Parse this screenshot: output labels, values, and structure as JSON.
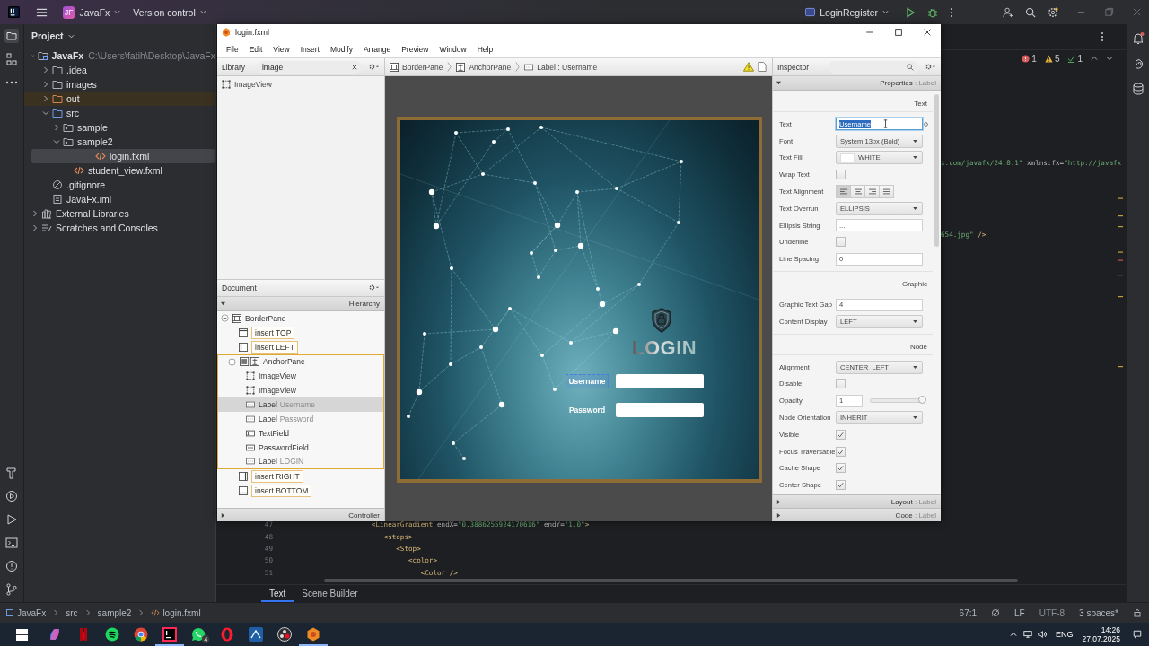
{
  "topbar": {
    "badge": "JF",
    "project": "JavaFx",
    "vcs": "Version control",
    "run_config": "LoginRegister"
  },
  "project": {
    "title": "Project",
    "tree": [
      {
        "label": "JavaFx",
        "detail": "C:\\Users\\fatih\\Desktop\\JavaFx",
        "kind": "module",
        "expanded": true,
        "selected": false,
        "children": [
          {
            "label": ".idea",
            "kind": "folder",
            "expanded": false,
            "selected": false
          },
          {
            "label": "images",
            "kind": "folder",
            "expanded": false,
            "selected": false
          },
          {
            "label": "out",
            "kind": "excluded",
            "expanded": false,
            "selected": false
          },
          {
            "label": "src",
            "kind": "source",
            "expanded": true,
            "selected": false,
            "children": [
              {
                "label": "sample",
                "kind": "package",
                "expanded": false,
                "selected": false
              },
              {
                "label": "sample2",
                "kind": "package",
                "expanded": true,
                "selected": false,
                "children": [
                  {
                    "label": "login.fxml",
                    "kind": "fxml",
                    "selected": true
                  },
                  {
                    "label": "student_view.fxml",
                    "kind": "fxml",
                    "selected": false
                  }
                ]
              }
            ]
          },
          {
            "label": ".gitignore",
            "kind": "ignore",
            "selected": false
          },
          {
            "label": "JavaFx.iml",
            "kind": "iml",
            "selected": false
          }
        ]
      },
      {
        "label": "External Libraries",
        "kind": "libraries",
        "expanded": false,
        "selected": false
      },
      {
        "label": "Scratches and Consoles",
        "kind": "scratches",
        "expanded": false,
        "selected": false
      }
    ]
  },
  "editor": {
    "inspections": {
      "errors": "1",
      "warnings": "5",
      "ok": "1"
    },
    "fragments": [
      [
        {
          "text": "x.com/javafx/24.0.1\"",
          "kind": "value"
        },
        {
          "text": " xmlns:fx",
          "kind": "attr"
        },
        {
          "text": "=",
          "kind": "plain"
        },
        {
          "text": "\"http://javafx",
          "kind": "value"
        }
      ],
      [
        {
          "text": "654.jpg\"",
          "kind": "value"
        },
        {
          "text": " />",
          "kind": "tag"
        }
      ]
    ],
    "lines": [
      {
        "number": "47",
        "tokens": [
          {
            "text": "            <LinearGradient",
            "kind": "tag"
          },
          {
            "text": " endX",
            "kind": "attr"
          },
          {
            "text": "=",
            "kind": "plain"
          },
          {
            "text": "\"0.3886255924170616\"",
            "kind": "value"
          },
          {
            "text": " endY",
            "kind": "attr"
          },
          {
            "text": "=",
            "kind": "plain"
          },
          {
            "text": "\"1.0\"",
            "kind": "value"
          },
          {
            "text": ">",
            "kind": "tag"
          }
        ]
      },
      {
        "number": "48",
        "tokens": [
          {
            "text": "               <stops>",
            "kind": "tag"
          }
        ]
      },
      {
        "number": "49",
        "tokens": [
          {
            "text": "                  <Stop>",
            "kind": "tag"
          }
        ]
      },
      {
        "number": "50",
        "tokens": [
          {
            "text": "                     <color>",
            "kind": "tag"
          }
        ]
      },
      {
        "number": "51",
        "tokens": [
          {
            "text": "                        <Color />",
            "kind": "tag"
          }
        ]
      }
    ],
    "tabs": [
      {
        "label": "Text",
        "selected": true
      },
      {
        "label": "Scene Builder",
        "selected": false
      }
    ]
  },
  "scene_builder": {
    "title": "login.fxml",
    "menu": [
      "File",
      "Edit",
      "View",
      "Insert",
      "Modify",
      "Arrange",
      "Preview",
      "Window",
      "Help"
    ],
    "library": {
      "title": "Library",
      "search": "image",
      "results": [
        "ImageView"
      ]
    },
    "document": {
      "title": "Document",
      "section": "Hierarchy",
      "footer": "Controller",
      "tree": [
        {
          "label": "BorderPane",
          "kind": "borderpane",
          "expanded": true,
          "selected": false,
          "children": [
            {
              "label": "insert TOP",
              "kind": "slot-top",
              "selected": false
            },
            {
              "label": "insert LEFT",
              "kind": "slot-left",
              "selected": false
            },
            {
              "label": "AnchorPane",
              "kind": "anchorpane",
              "expanded": true,
              "selected": false,
              "children": [
                {
                  "label": "ImageView",
                  "kind": "imageview",
                  "selected": false
                },
                {
                  "label": "ImageView",
                  "kind": "imageview",
                  "selected": false
                },
                {
                  "label": "Label",
                  "detail": "Username",
                  "kind": "label",
                  "selected": true
                },
                {
                  "label": "Label",
                  "detail": "Password",
                  "kind": "label",
                  "selected": false
                },
                {
                  "label": "TextField",
                  "kind": "textfield",
                  "selected": false
                },
                {
                  "label": "PasswordField",
                  "kind": "passwordfield",
                  "selected": false
                },
                {
                  "label": "Label",
                  "detail": "LOGIN",
                  "kind": "label",
                  "selected": false
                }
              ]
            },
            {
              "label": "insert RIGHT",
              "kind": "slot-right",
              "selected": false
            },
            {
              "label": "insert BOTTOM",
              "kind": "slot-bottom",
              "selected": false
            }
          ]
        }
      ]
    },
    "breadcrumb": [
      {
        "label": "BorderPane",
        "kind": "borderpane"
      },
      {
        "label": "AnchorPane",
        "kind": "anchorpane"
      },
      {
        "label": "Label : Username",
        "kind": "label"
      }
    ],
    "canvas": {
      "title": "LOGIN",
      "fields": [
        {
          "label": "Username",
          "selected": true
        },
        {
          "label": "Password",
          "selected": false
        }
      ]
    },
    "inspector": {
      "title": "Inspector",
      "header": {
        "title": "Properties",
        "target": ": Label"
      },
      "groups": [
        {
          "title": "Text",
          "rows": [
            {
              "label": "Text",
              "kind": "input",
              "value": "Username",
              "focused": true
            },
            {
              "label": "Font",
              "kind": "dropdown",
              "value": "System 13px (Bold)"
            },
            {
              "label": "Text Fill",
              "kind": "color",
              "value": "WHITE",
              "color": "#ffffff"
            },
            {
              "label": "Wrap Text",
              "kind": "checkbox",
              "checked": false
            },
            {
              "label": "Text Alignment",
              "kind": "align",
              "options": [
                {
                  "kind": "left",
                  "selected": true
                },
                {
                  "kind": "center",
                  "selected": false
                },
                {
                  "kind": "right",
                  "selected": false
                },
                {
                  "kind": "justify",
                  "selected": false
                }
              ]
            },
            {
              "label": "Text Overrun",
              "kind": "dropdown",
              "value": "ELLIPSIS"
            },
            {
              "label": "Ellipsis String",
              "kind": "input",
              "value": "...",
              "focused": false
            },
            {
              "label": "Underline",
              "kind": "checkbox",
              "checked": false
            },
            {
              "label": "Line Spacing",
              "kind": "input",
              "value": "0",
              "focused": false
            }
          ]
        },
        {
          "title": "Graphic",
          "rows": [
            {
              "label": "Graphic Text Gap",
              "kind": "input",
              "value": "4",
              "focused": false
            },
            {
              "label": "Content Display",
              "kind": "dropdown",
              "value": "LEFT"
            }
          ]
        },
        {
          "title": "Node",
          "rows": [
            {
              "label": "Alignment",
              "kind": "dropdown",
              "value": "CENTER_LEFT"
            },
            {
              "label": "Disable",
              "kind": "checkbox",
              "checked": false
            },
            {
              "label": "Opacity",
              "kind": "slider",
              "value": "1",
              "level": 1
            },
            {
              "label": "Node Orientation",
              "kind": "dropdown",
              "value": "INHERIT"
            },
            {
              "label": "Visible",
              "kind": "checkbox",
              "checked": true
            },
            {
              "label": "Focus Traversable",
              "kind": "checkbox",
              "checked": true
            },
            {
              "label": "Cache Shape",
              "kind": "checkbox",
              "checked": true
            },
            {
              "label": "Center Shape",
              "kind": "checkbox",
              "checked": true
            }
          ]
        }
      ],
      "footers": [
        {
          "title": "Layout",
          "target": ": Label"
        },
        {
          "title": "Code",
          "target": ": Label"
        }
      ]
    }
  },
  "status": {
    "path": [
      {
        "label": "JavaFx",
        "kind": "module"
      },
      {
        "label": "src",
        "kind": "folder"
      },
      {
        "label": "sample2",
        "kind": "folder"
      },
      {
        "label": "login.fxml",
        "kind": "fxml"
      }
    ],
    "position": "67:1",
    "line_ending": "LF",
    "encoding": "UTF-8",
    "indent": "3 spaces*"
  },
  "taskbar": {
    "apps": [
      {
        "kind": "copilot",
        "active": false
      },
      {
        "kind": "netflix",
        "active": false
      },
      {
        "kind": "spotify",
        "active": false
      },
      {
        "kind": "chrome",
        "active": false
      },
      {
        "kind": "intellij",
        "active": true
      },
      {
        "kind": "whatsapp",
        "active": false,
        "badge": "4"
      },
      {
        "kind": "opera",
        "active": false
      },
      {
        "kind": "blue-app",
        "active": false
      },
      {
        "kind": "obs",
        "active": false
      },
      {
        "kind": "scenebuilder",
        "active": true
      }
    ],
    "language": "ENG",
    "time": "14:26",
    "date": "27.07.2025"
  }
}
